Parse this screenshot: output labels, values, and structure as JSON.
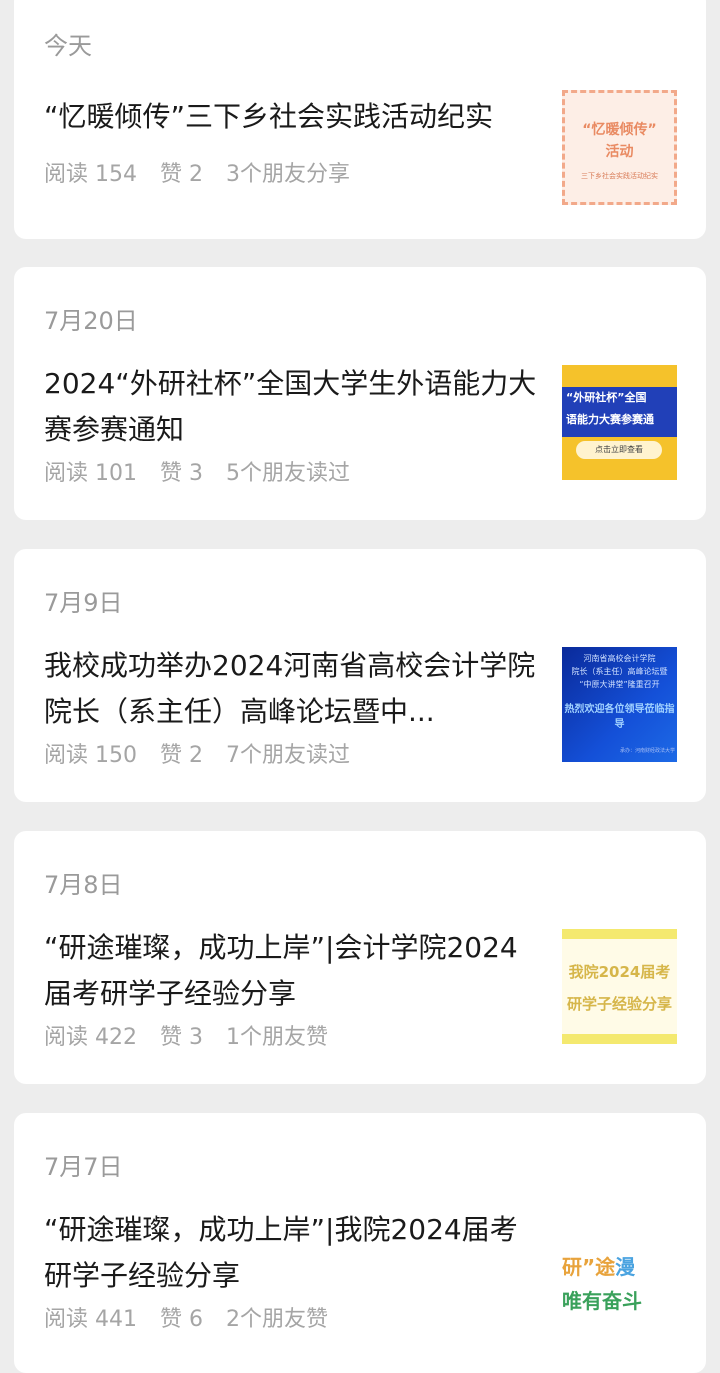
{
  "feed": {
    "items": [
      {
        "date": "今天",
        "title": "“忆暖倾传”三下乡社会实践活动纪实",
        "reads": "阅读 154",
        "likes": "赞 2",
        "social": "3个朋友分享",
        "thumb": {
          "line1": "“忆暖倾传”",
          "line2": "活动",
          "line3": "三下乡社会实践活动纪实"
        }
      },
      {
        "date": "7月20日",
        "title": "2024“外研社杯”全国大学生外语能力大赛参赛通知",
        "reads": "阅读 101",
        "likes": "赞 3",
        "social": "5个朋友读过",
        "thumb": {
          "line1": "“外研社杯”全国",
          "line2": "语能力大赛参赛通",
          "button": "点击立即查看"
        }
      },
      {
        "date": "7月9日",
        "title": "我校成功举办2024河南省高校会计学院院长（系主任）高峰论坛暨中...",
        "reads": "阅读 150",
        "likes": "赞 2",
        "social": "7个朋友读过",
        "thumb": {
          "line1": "河南省高校会计学院",
          "line2": "院长（系主任）高峰论坛暨",
          "line3": "“中原大讲堂”隆重召开",
          "line4": "热烈欢迎各位领导莅临指导",
          "line5": "承办：河南财经政法大学"
        }
      },
      {
        "date": "7月8日",
        "title": "“研途璀璨，成功上岸”|会计学院2024届考研学子经验分享",
        "reads": "阅读 422",
        "likes": "赞 3",
        "social": "1个朋友赞",
        "thumb": {
          "line1": "我院2024届考",
          "line2": "研学子经验分享"
        }
      },
      {
        "date": "7月7日",
        "title": "“研途璀璨，成功上岸”|我院2024届考研学子经验分享",
        "reads": "阅读 441",
        "likes": "赞 6",
        "social": "2个朋友赞",
        "thumb": {
          "line1": "研”途漫",
          "line2": "唯有奋斗"
        }
      }
    ]
  }
}
